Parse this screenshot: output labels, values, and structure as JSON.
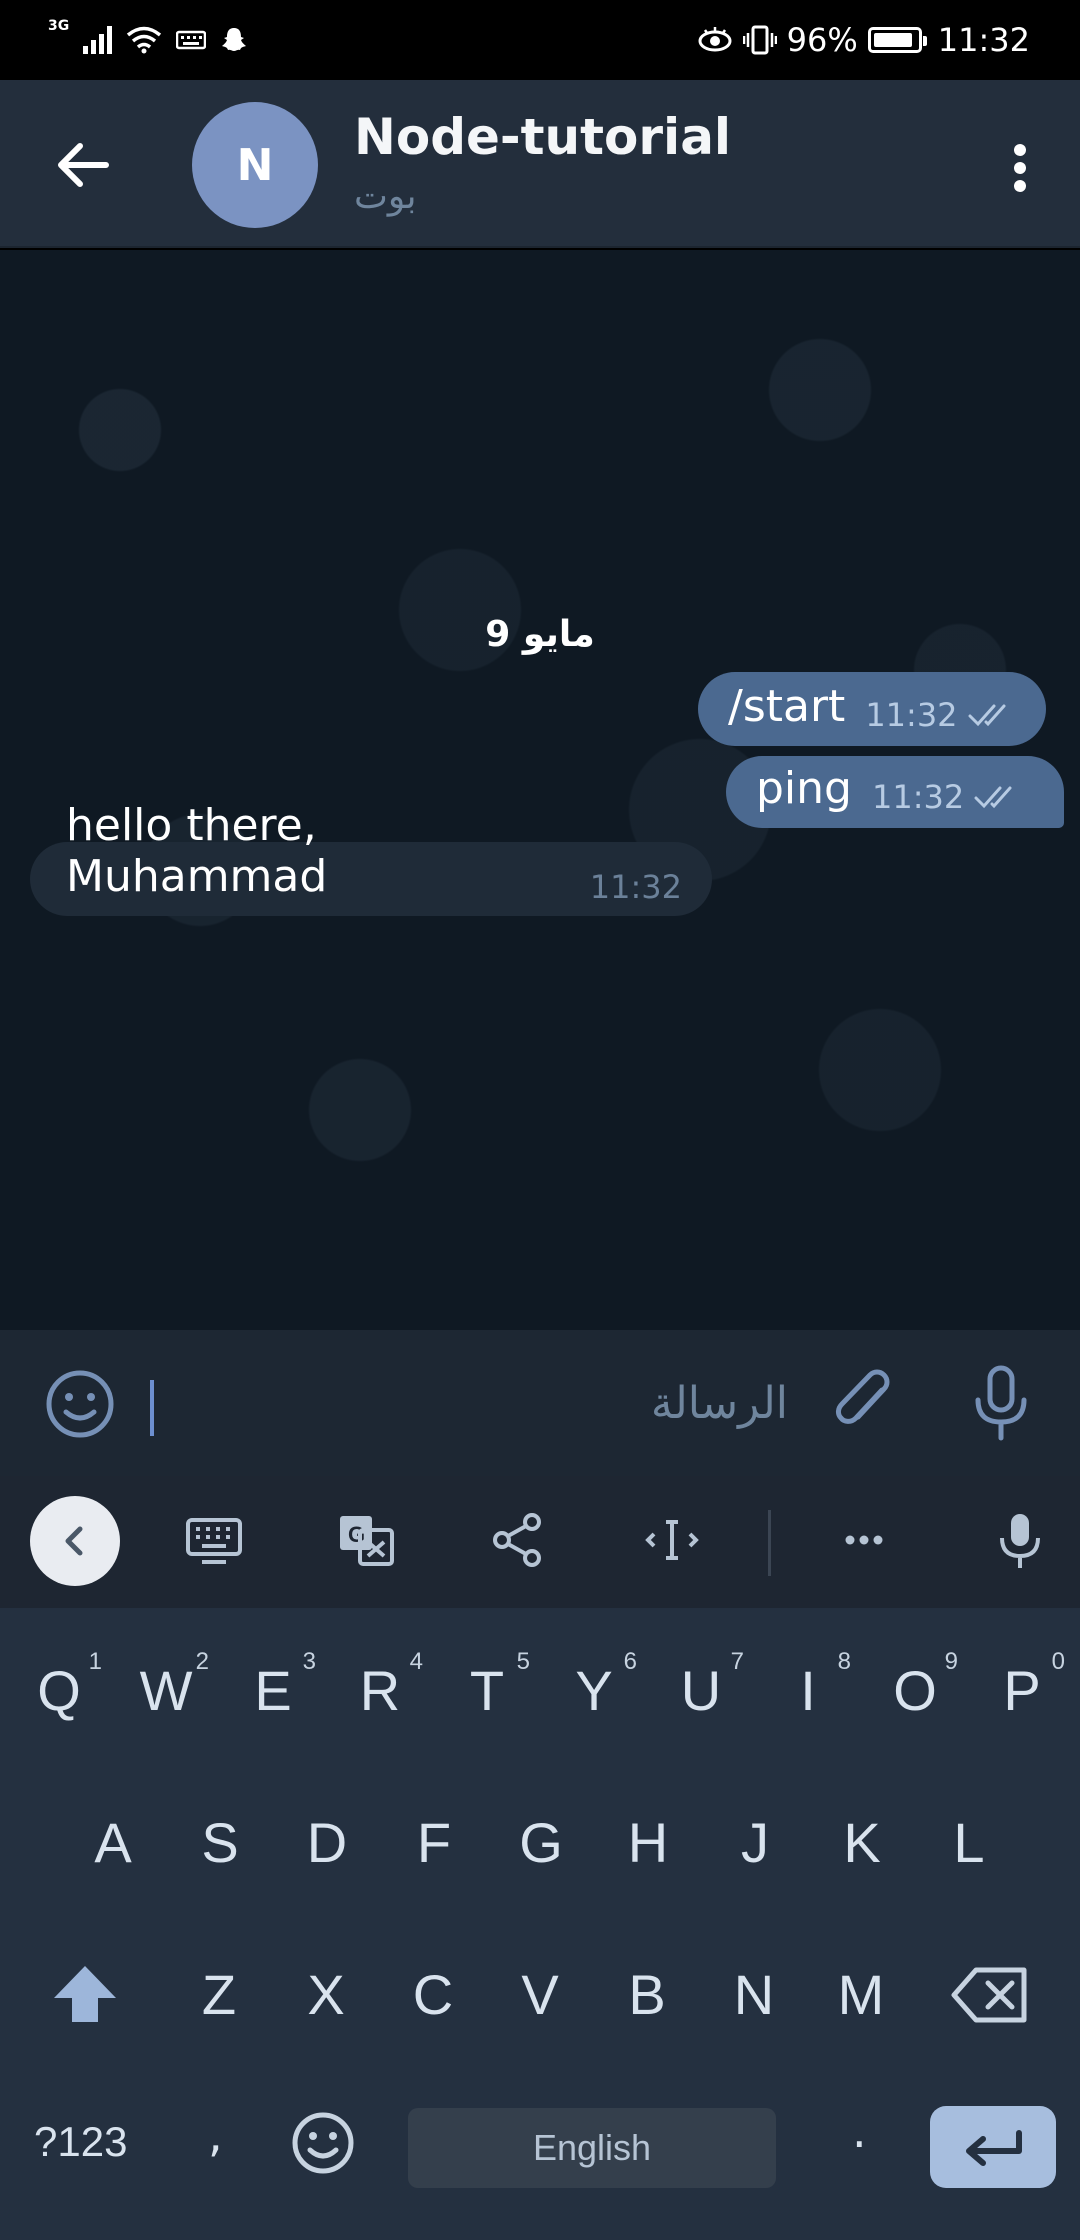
{
  "statusbar": {
    "network": "3G",
    "battery": "96%",
    "time": "11:32"
  },
  "header": {
    "avatar_letter": "N",
    "title": "Node-tutorial",
    "subtitle": "بوت"
  },
  "chat": {
    "date": "9 مايو",
    "messages": [
      {
        "direction": "out",
        "text": "/start",
        "time": "11:32"
      },
      {
        "direction": "out",
        "text": "ping",
        "time": "11:32"
      },
      {
        "direction": "in",
        "text": "hello there, Muhammad",
        "time": "11:32"
      }
    ]
  },
  "composer": {
    "placeholder": "الرسالة"
  },
  "keyboard": {
    "row1": [
      {
        "k": "Q",
        "n": "1"
      },
      {
        "k": "W",
        "n": "2"
      },
      {
        "k": "E",
        "n": "3"
      },
      {
        "k": "R",
        "n": "4"
      },
      {
        "k": "T",
        "n": "5"
      },
      {
        "k": "Y",
        "n": "6"
      },
      {
        "k": "U",
        "n": "7"
      },
      {
        "k": "I",
        "n": "8"
      },
      {
        "k": "O",
        "n": "9"
      },
      {
        "k": "P",
        "n": "0"
      }
    ],
    "row2": [
      "A",
      "S",
      "D",
      "F",
      "G",
      "H",
      "J",
      "K",
      "L"
    ],
    "row3": [
      "Z",
      "X",
      "C",
      "V",
      "B",
      "N",
      "M"
    ],
    "symbols_label": "?123",
    "comma": ",",
    "period": ".",
    "space_label": "English"
  },
  "colors": {
    "header_bg": "#232e3c",
    "chat_bg": "#0f1923",
    "out_bubble": "#4b6990",
    "in_bubble": "#1f2b38",
    "keyboard_bg": "#243040",
    "enter_key": "#a7bede"
  }
}
